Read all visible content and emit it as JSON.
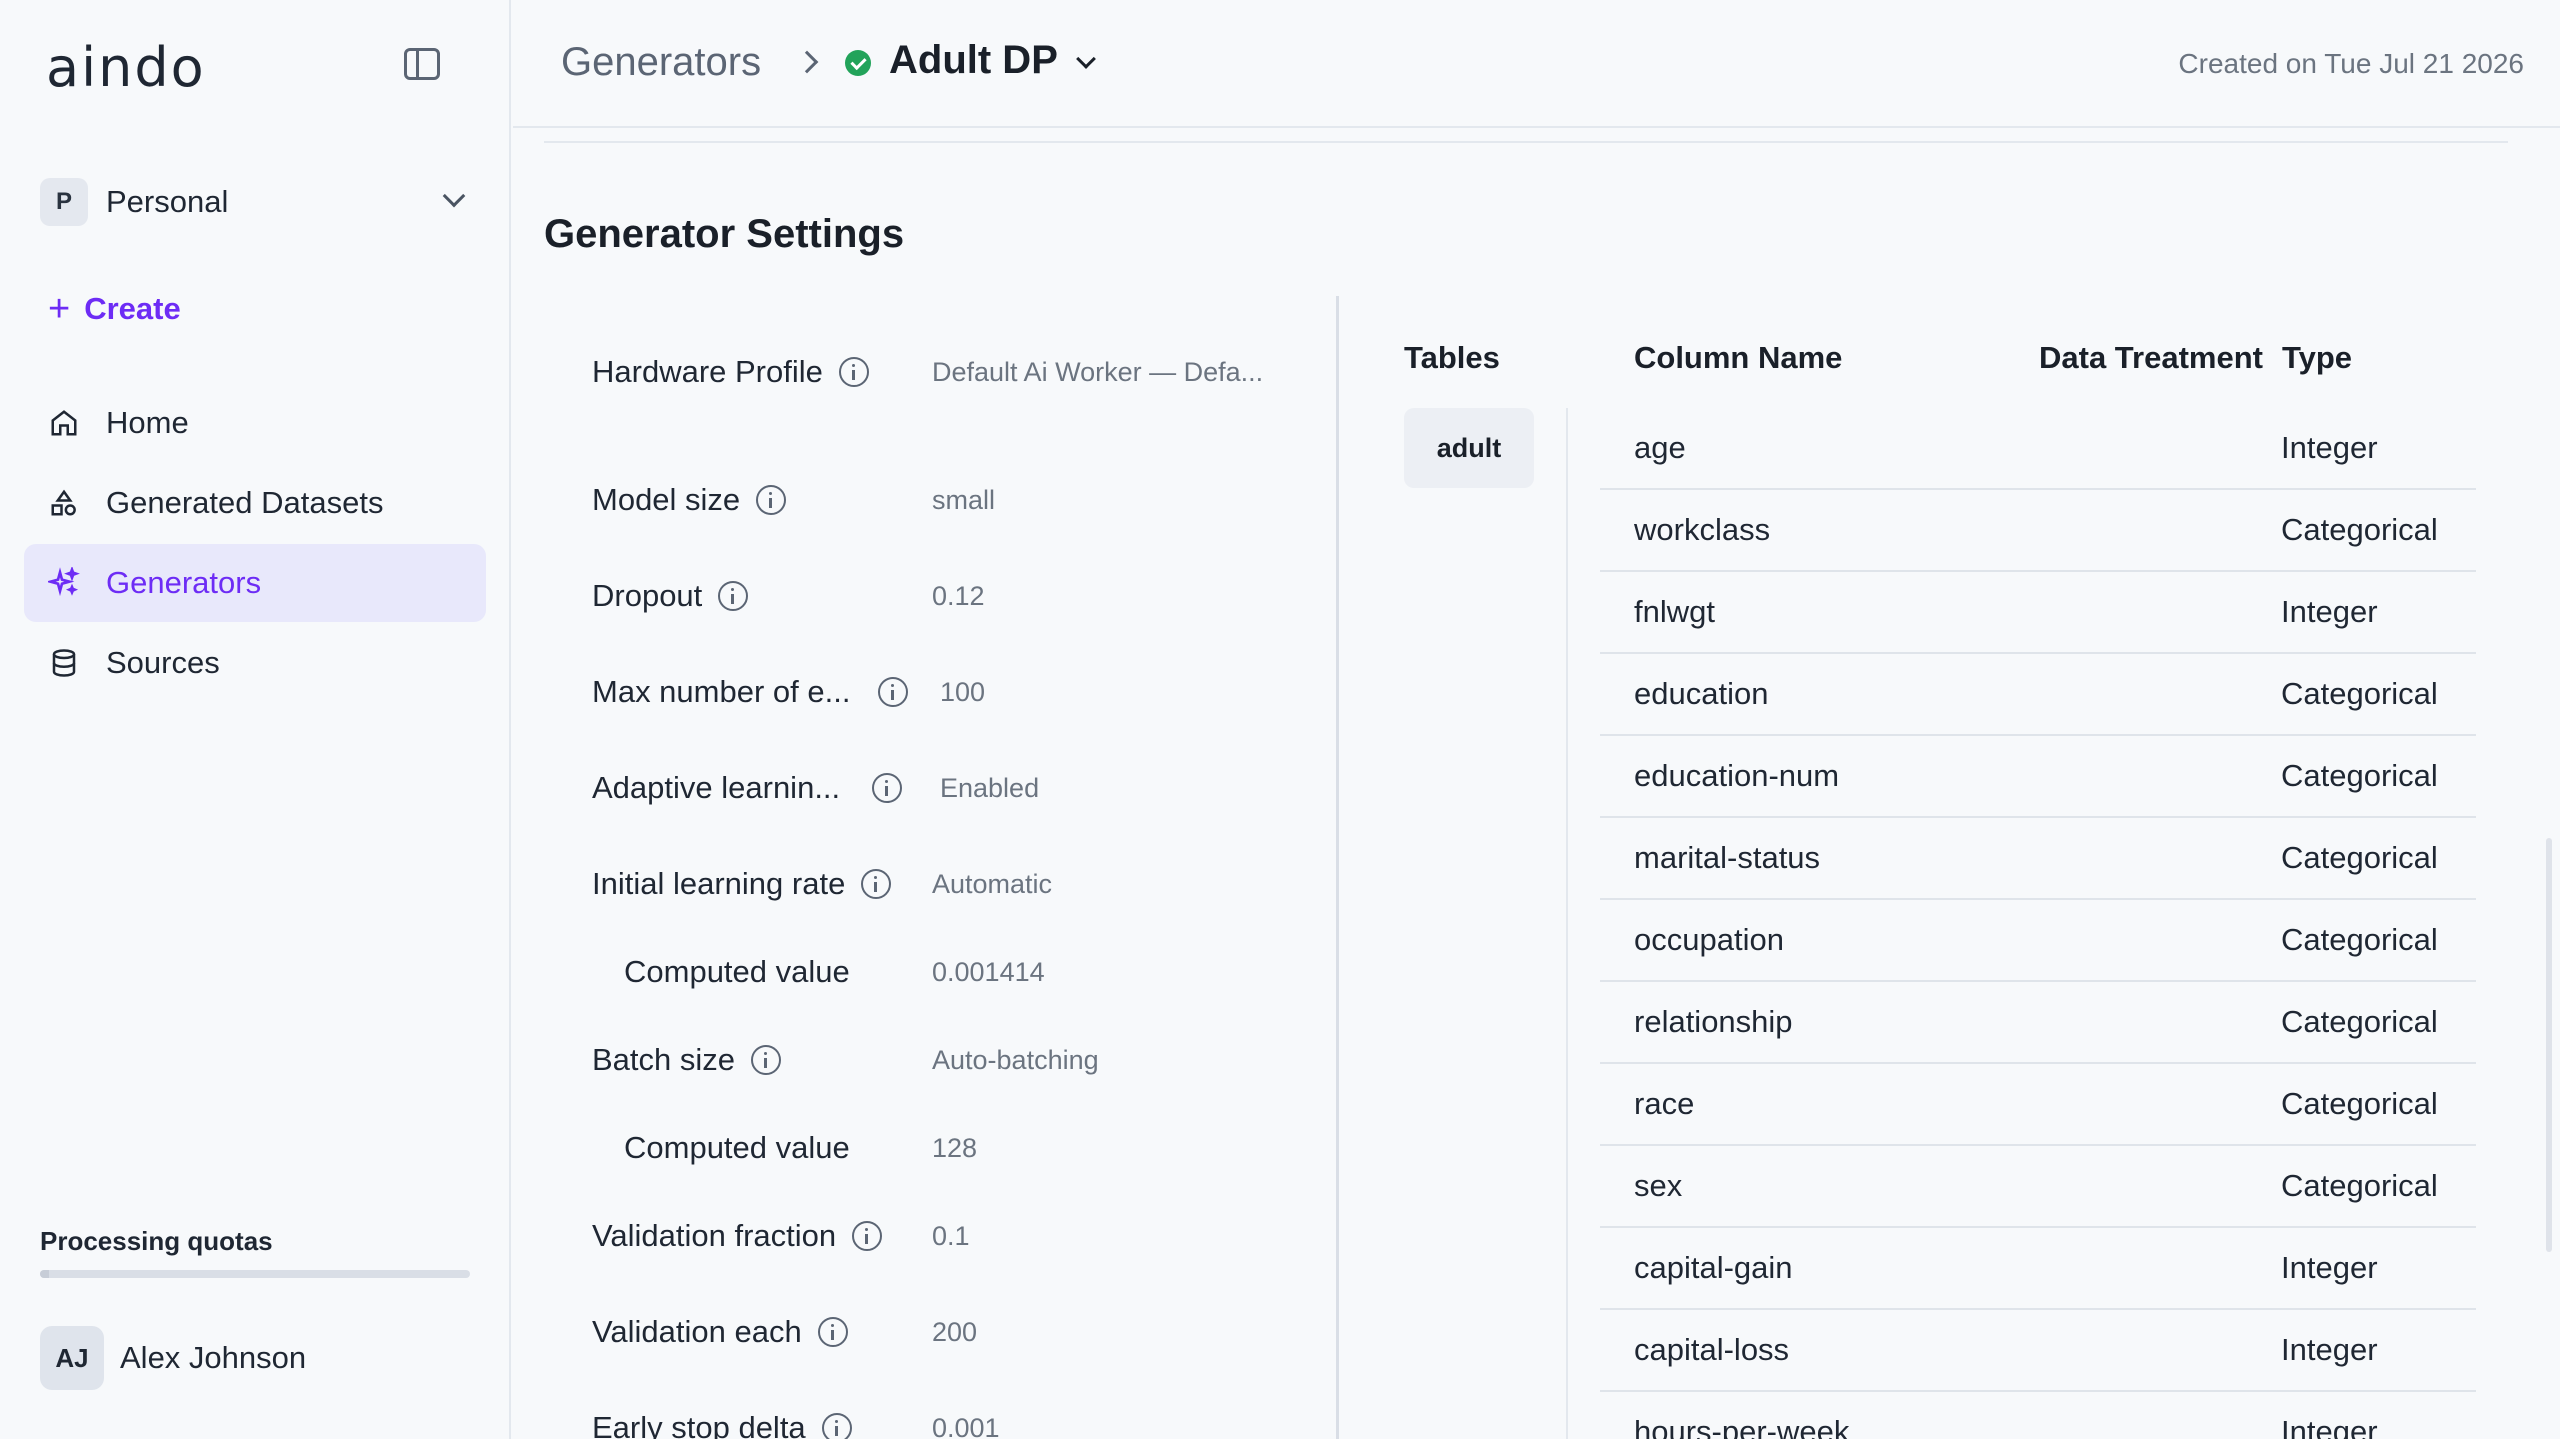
{
  "app": {
    "logo": "aindo"
  },
  "sidebar": {
    "workspace": {
      "initial": "P",
      "name": "Personal"
    },
    "create_label": "Create",
    "nav": [
      {
        "label": "Home",
        "icon": "home-icon"
      },
      {
        "label": "Generated Datasets",
        "icon": "shapes-icon"
      },
      {
        "label": "Generators",
        "icon": "sparkles-icon",
        "active": true
      },
      {
        "label": "Sources",
        "icon": "database-icon"
      }
    ],
    "quotas_title": "Processing quotas",
    "quota_fraction": 0.02,
    "user": {
      "initials": "AJ",
      "name": "Alex Johnson"
    }
  },
  "header": {
    "breadcrumb_root": "Generators",
    "current": "Adult DP",
    "status_color": "#22a35a",
    "created": "Created on Tue Jul 21 2026"
  },
  "main": {
    "section_title": "Generator Settings",
    "settings": [
      {
        "label": "Hardware Profile",
        "value": "Default Ai Worker — Defa...",
        "info": true
      },
      {
        "label": "Model size",
        "value": "small",
        "info": true
      },
      {
        "label": "Dropout",
        "value": "0.12",
        "info": true
      },
      {
        "label": "Max number of e...",
        "value": "100",
        "info": true
      },
      {
        "label": "Adaptive learnin...",
        "value": "Enabled",
        "info": true
      },
      {
        "label": "Initial learning rate",
        "value": "Automatic",
        "info": true
      },
      {
        "label": "Computed value",
        "value": "0.001414",
        "info": false
      },
      {
        "label": "Batch size",
        "value": "Auto-batching",
        "info": true
      },
      {
        "label": "Computed value",
        "value": "128",
        "info": false
      },
      {
        "label": "Validation fraction",
        "value": "0.1",
        "info": true
      },
      {
        "label": "Validation each",
        "value": "200",
        "info": true
      },
      {
        "label": "Early stop delta",
        "value": "0.001",
        "info": true
      }
    ],
    "tables_header": "Tables",
    "column_name_header": "Column Name",
    "data_treatment_header": "Data Treatment",
    "type_header": "Type",
    "selected_table": "adult",
    "columns": [
      {
        "name": "age",
        "type": "Integer"
      },
      {
        "name": "workclass",
        "type": "Categorical"
      },
      {
        "name": "fnlwgt",
        "type": "Integer"
      },
      {
        "name": "education",
        "type": "Categorical"
      },
      {
        "name": "education-num",
        "type": "Categorical"
      },
      {
        "name": "marital-status",
        "type": "Categorical"
      },
      {
        "name": "occupation",
        "type": "Categorical"
      },
      {
        "name": "relationship",
        "type": "Categorical"
      },
      {
        "name": "race",
        "type": "Categorical"
      },
      {
        "name": "sex",
        "type": "Categorical"
      },
      {
        "name": "capital-gain",
        "type": "Integer"
      },
      {
        "name": "capital-loss",
        "type": "Integer"
      },
      {
        "name": "hours-per-week",
        "type": "Integer"
      }
    ]
  }
}
